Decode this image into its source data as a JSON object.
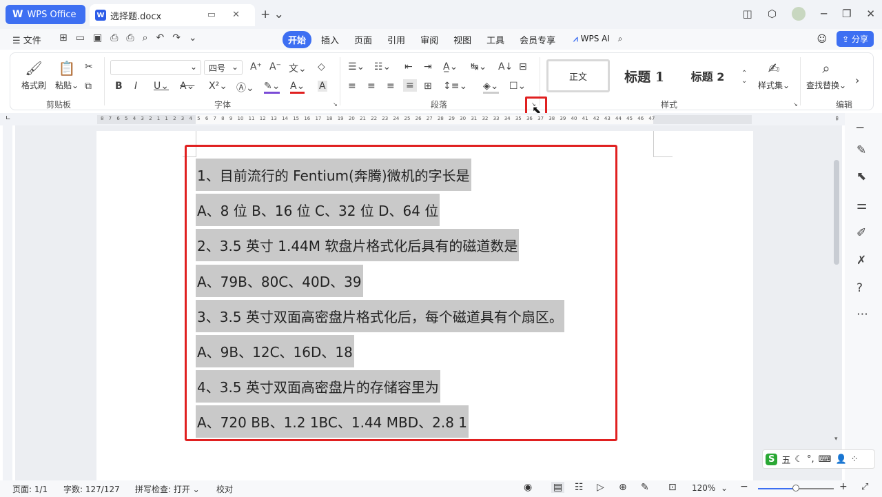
{
  "titlebar": {
    "app_tab": "WPS Office",
    "doc_tab": "选择题.docx",
    "new_tab": "+ ⌄"
  },
  "menubar": {
    "file": "☰ 文件",
    "tabs": [
      "开始",
      "插入",
      "页面",
      "引用",
      "审阅",
      "视图",
      "工具",
      "会员专享"
    ],
    "ai": "WPS AI",
    "share": "分享"
  },
  "ribbon": {
    "clipboard": {
      "format_painter": "格式刷",
      "paste": "粘贴",
      "label": "剪贴板"
    },
    "font": {
      "font_name": "",
      "font_size": "四号",
      "label": "字体"
    },
    "paragraph": {
      "label": "段落"
    },
    "styles": {
      "normal": "正文",
      "heading1": "标题 1",
      "heading2": "标题 2",
      "style_set": "样式集",
      "label": "样式"
    },
    "edit": {
      "find_replace": "查找替换",
      "label": "编辑"
    }
  },
  "ruler": {
    "numbers": "8 7 6 5 4 3 2 1 1 2 3 4 5 6 7 8 9 10 11 12 13 14 15 16 17 18 19 20 21 22 23 24 25 26 27 28 29 30 31 32 33 34 35 36 37 38 39 40 41 42 43 44 45 46 47"
  },
  "document": {
    "lines": [
      "1、目前流行的 Fentium(奔腾)微机的字长是",
      "A、8 位 B、16 位 C、32 位 D、64 位",
      "2、3.5 英寸 1.44M 软盘片格式化后具有的磁道数是",
      "A、79B、80C、40D、39",
      "3、3.5 英寸双面高密盘片格式化后，每个磁道具有个扇区。",
      "A、9B、12C、16D、18",
      "4、3.5 英寸双面高密盘片的存储容里为",
      "A、720 BB、1.2 1BC、1.44 MBD、2.8 1"
    ]
  },
  "ime": {
    "label": "五"
  },
  "statusbar": {
    "page": "页面: 1/1",
    "word_count": "字数: 127/127",
    "spell_check": "拼写检查: 打开 ⌄",
    "proofread": "校对",
    "zoom": "120%",
    "zoom_level": 0.5
  },
  "colors": {
    "accent": "#3d6ff2",
    "highlight": "#e02020",
    "selection": "#c9c9c9"
  }
}
